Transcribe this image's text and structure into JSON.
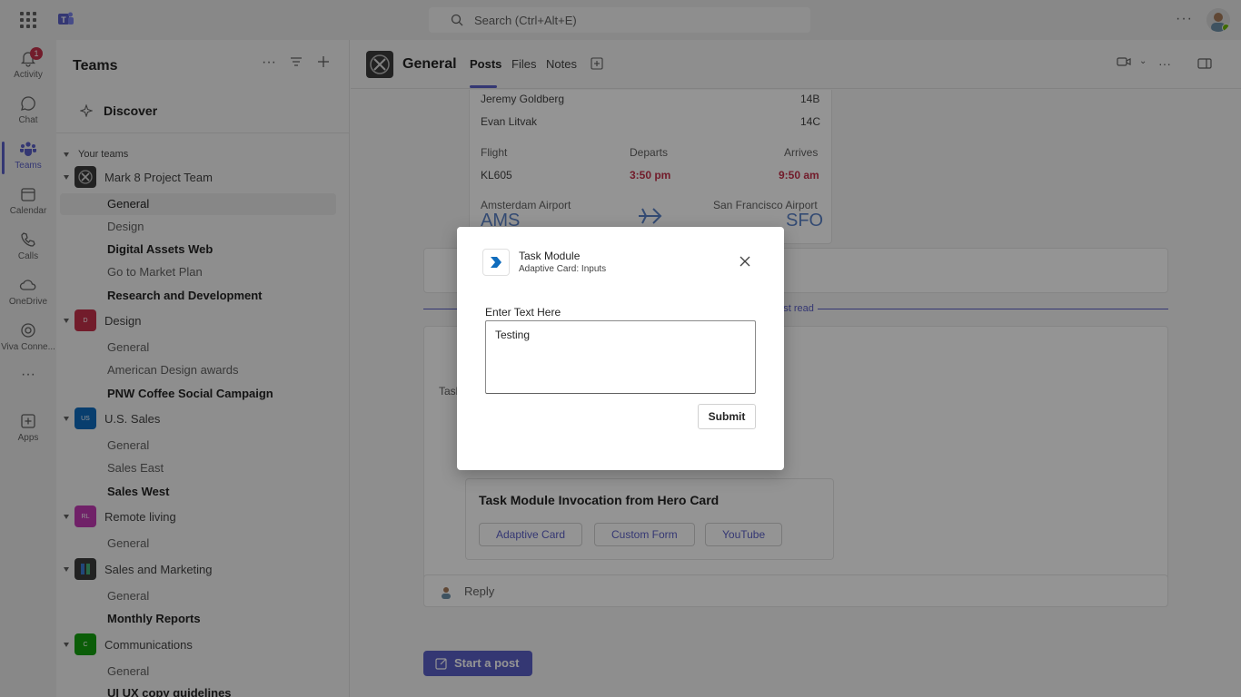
{
  "topbar": {
    "search_placeholder": "Search (Ctrl+Alt+E)",
    "more": "···"
  },
  "rail": [
    {
      "label": "Activity",
      "icon": "bell-icon",
      "badge": "1"
    },
    {
      "label": "Chat",
      "icon": "chat-icon"
    },
    {
      "label": "Teams",
      "icon": "teams-icon",
      "active": true
    },
    {
      "label": "Calendar",
      "icon": "calendar-icon"
    },
    {
      "label": "Calls",
      "icon": "phone-icon"
    },
    {
      "label": "OneDrive",
      "icon": "cloud-icon"
    },
    {
      "label": "Viva Conne...",
      "icon": "viva-icon"
    },
    {
      "label": "···",
      "icon": "more-icon"
    },
    {
      "label": "Apps",
      "icon": "add-app-icon"
    }
  ],
  "sidebar": {
    "title": "Teams",
    "discover": "Discover",
    "your_teams": "Your teams",
    "teams": [
      {
        "name": "Mark 8 Project Team",
        "avatar_color": "#3b3b3b",
        "channels": [
          {
            "name": "General",
            "bold": false,
            "selected": true
          },
          {
            "name": "Design",
            "bold": false
          },
          {
            "name": "Digital Assets Web",
            "bold": true
          },
          {
            "name": "Go to Market Plan",
            "bold": false
          },
          {
            "name": "Research and Development",
            "bold": true
          }
        ]
      },
      {
        "name": "Design",
        "avatar_color": "#c4314b",
        "initials": "D",
        "channels": [
          {
            "name": "General",
            "bold": false
          },
          {
            "name": "American Design awards",
            "bold": false
          },
          {
            "name": "PNW Coffee Social Campaign",
            "bold": true
          }
        ]
      },
      {
        "name": "U.S. Sales",
        "avatar_color": "#0f6cbd",
        "initials": "US",
        "channels": [
          {
            "name": "General",
            "bold": false
          },
          {
            "name": "Sales East",
            "bold": false
          },
          {
            "name": "Sales West",
            "bold": true
          }
        ]
      },
      {
        "name": "Remote living",
        "avatar_color": "#c239b3",
        "initials": "RL",
        "channels": [
          {
            "name": "General",
            "bold": false
          }
        ]
      },
      {
        "name": "Sales and Marketing",
        "avatar_color": "#3b3b3b",
        "channels": [
          {
            "name": "General",
            "bold": false
          },
          {
            "name": "Monthly Reports",
            "bold": true
          }
        ]
      },
      {
        "name": "Communications",
        "avatar_color": "#13a10e",
        "initials": "C",
        "channels": [
          {
            "name": "General",
            "bold": false
          },
          {
            "name": "UI UX copy guidelines",
            "bold": true
          }
        ]
      }
    ]
  },
  "header": {
    "channel": "General",
    "tabs": [
      "Posts",
      "Files",
      "Notes"
    ],
    "active_tab": "Posts"
  },
  "flight_card": {
    "passengers": [
      {
        "name": "Jeremy Goldberg",
        "seat": "14B"
      },
      {
        "name": "Evan Litvak",
        "seat": "14C"
      }
    ],
    "flight_label": "Flight",
    "departs_label": "Departs",
    "arrives_label": "Arrives",
    "flight": "KL605",
    "departs": "3:50 pm",
    "arrives": "9:50 am",
    "from_airport": "Amsterdam Airport",
    "from_code": "AMS",
    "to_airport": "San Francisco Airport",
    "to_code": "SFO"
  },
  "feed": {
    "last_read": "Last read",
    "hero_title": "Task Module Invocation from Hero Card",
    "hero_buttons": [
      "Adaptive Card",
      "Custom Form",
      "YouTube"
    ],
    "task_text": "Task",
    "reply": "Reply",
    "start_post": "Start a post"
  },
  "dialog": {
    "title": "Task Module",
    "subtitle": "Adaptive Card: Inputs",
    "field_label": "Enter Text Here",
    "field_value": "Testing",
    "submit": "Submit"
  },
  "colors": {
    "accent": "#5b5fc7",
    "danger": "#c4314b"
  }
}
